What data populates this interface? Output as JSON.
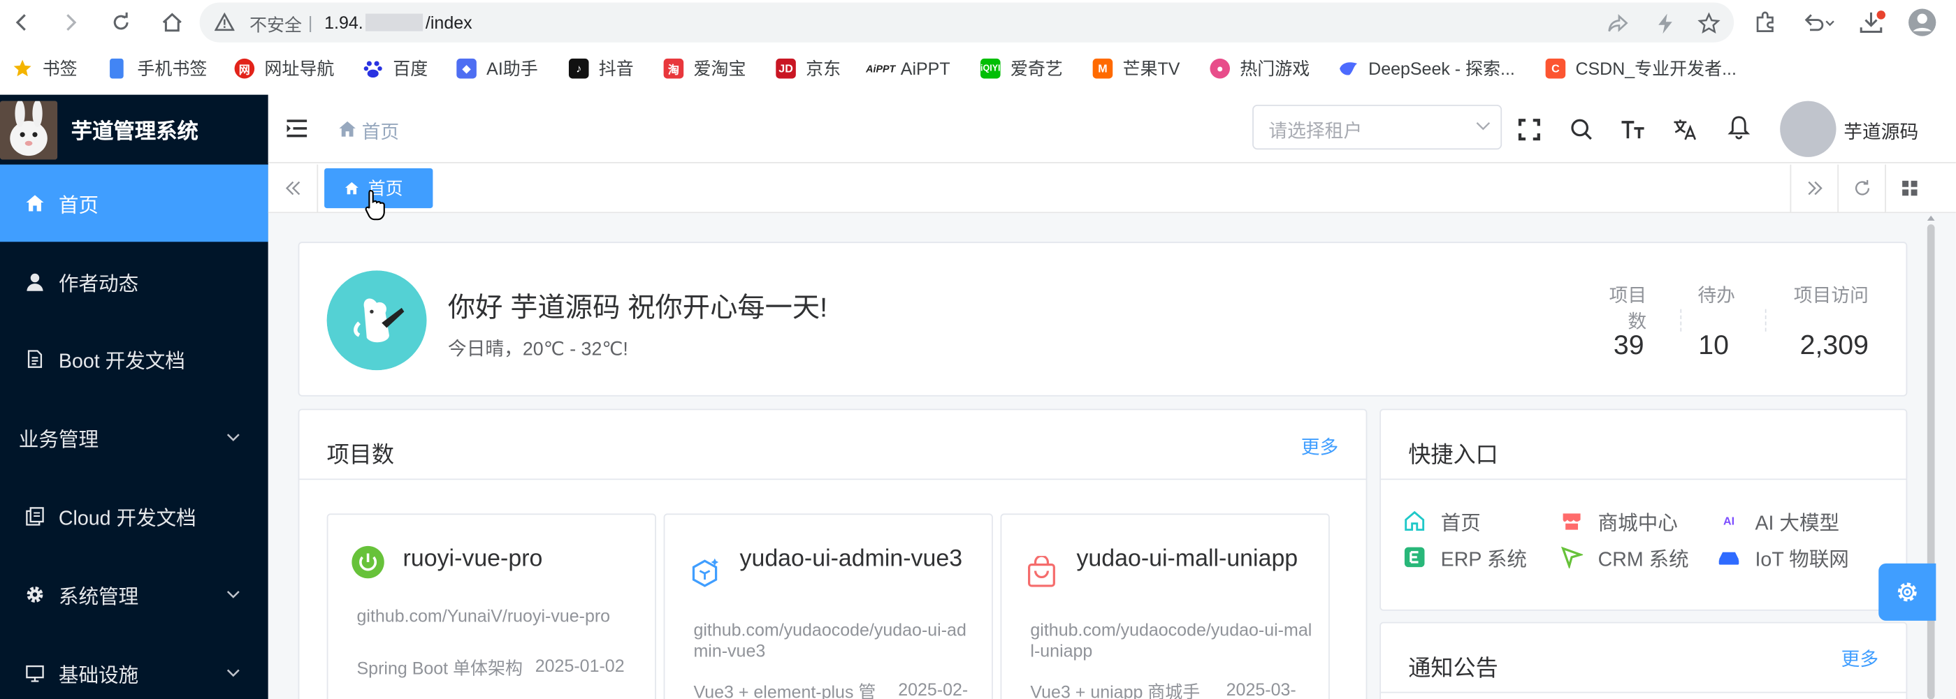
{
  "browser": {
    "url_insecure": "不安全",
    "url_separator": "|",
    "url_prefix": "1.94.",
    "url_suffix": "/index"
  },
  "bookmarks": [
    {
      "label": "书签",
      "icon": "star-icon",
      "color": "#f4b400"
    },
    {
      "label": "手机书签",
      "icon": "phone-icon",
      "color": "#4285f4"
    },
    {
      "label": "网址导航",
      "icon": "nav-site-icon",
      "color": "#e2231a"
    },
    {
      "label": "百度",
      "icon": "baidu-icon",
      "color": "#2932e1"
    },
    {
      "label": "AI助手",
      "icon": "ai-assistant-icon",
      "color": "#4e6ef2"
    },
    {
      "label": "抖音",
      "icon": "douyin-icon",
      "color": "#111111"
    },
    {
      "label": "爱淘宝",
      "icon": "taobao-icon",
      "color": "#e8373c"
    },
    {
      "label": "京东",
      "icon": "jd-icon",
      "color": "#c91623"
    },
    {
      "label": "AiPPT",
      "icon": "aippt-icon",
      "color": "#222222"
    },
    {
      "label": "爱奇艺",
      "icon": "iqiyi-icon",
      "color": "#00be06"
    },
    {
      "label": "芒果TV",
      "icon": "mango-tv-icon",
      "color": "#ff6a00"
    },
    {
      "label": "热门游戏",
      "icon": "game-icon",
      "color": "#e84d8a"
    },
    {
      "label": "DeepSeek - 探索...",
      "icon": "deepseek-icon",
      "color": "#4d6bfe"
    },
    {
      "label": "CSDN_专业开发者...",
      "icon": "csdn-icon",
      "color": "#fc5531"
    }
  ],
  "sidebar": {
    "title": "芋道管理系统",
    "items": [
      {
        "label": "首页",
        "icon": "home-icon",
        "active": true,
        "has_children": false
      },
      {
        "label": "作者动态",
        "icon": "user-icon",
        "active": false,
        "has_children": false
      },
      {
        "label": "Boot 开发文档",
        "icon": "document-icon",
        "active": false,
        "has_children": false
      },
      {
        "label": "业务管理",
        "icon": "",
        "active": false,
        "has_children": true
      },
      {
        "label": "Cloud 开发文档",
        "icon": "copy-document-icon",
        "active": false,
        "has_children": false
      },
      {
        "label": "系统管理",
        "icon": "gear-icon",
        "active": false,
        "has_children": true
      },
      {
        "label": "基础设施",
        "icon": "monitor-icon",
        "active": false,
        "has_children": true
      }
    ]
  },
  "header": {
    "breadcrumb": "首页",
    "tenant_placeholder": "请选择租户",
    "username": "芋道源码"
  },
  "tags": {
    "active_label": "首页"
  },
  "welcome": {
    "title": "你好 芋道源码 祝你开心每一天!",
    "subtitle": "今日晴，20℃ - 32℃!",
    "stats": [
      {
        "label": "项目数",
        "value": "39"
      },
      {
        "label": "待办",
        "value": "10"
      },
      {
        "label": "项目访问",
        "value": "2,309"
      }
    ]
  },
  "projects_card": {
    "title": "项目数",
    "more": "更多",
    "projects": [
      {
        "name": "ruoyi-vue-pro",
        "url": "github.com/YunaiV/ruoyi-vue-pro",
        "desc": "Spring Boot 单体架构",
        "date": "2025-01-02",
        "icon": "power-icon",
        "color": "#67c23a"
      },
      {
        "name": "yudao-ui-admin-vue3",
        "url": "github.com/yudaocode/yudao-ui-admin-vue3",
        "desc": "Vue3 + element-plus 管",
        "date": "2025-02-",
        "icon": "vue-cube-icon",
        "color": "#409eff"
      },
      {
        "name": "yudao-ui-mall-uniapp",
        "url": "github.com/yudaocode/yudao-ui-mall-uniapp",
        "desc": "Vue3 + uniapp 商城手",
        "date": "2025-03-",
        "icon": "shopping-bag-icon",
        "color": "#f56c6c"
      }
    ]
  },
  "quick_card": {
    "title": "快捷入口",
    "items": [
      {
        "label": "首页",
        "icon": "home-outline-icon",
        "color": "#1fc8c8"
      },
      {
        "label": "商城中心",
        "icon": "shop-icon",
        "color": "#ff6b6b"
      },
      {
        "label": "AI 大模型",
        "icon": "ai-model-icon",
        "color": "#7c4dff"
      },
      {
        "label": "ERP 系统",
        "icon": "erp-icon",
        "color": "#28b779"
      },
      {
        "label": "CRM 系统",
        "icon": "crm-icon",
        "color": "#67c23a"
      },
      {
        "label": "IoT 物联网",
        "icon": "iot-icon",
        "color": "#2f6bff"
      }
    ]
  },
  "notice_card": {
    "title": "通知公告",
    "more": "更多"
  },
  "colors": {
    "primary": "#409eff",
    "sidebar_bg": "#001529"
  }
}
